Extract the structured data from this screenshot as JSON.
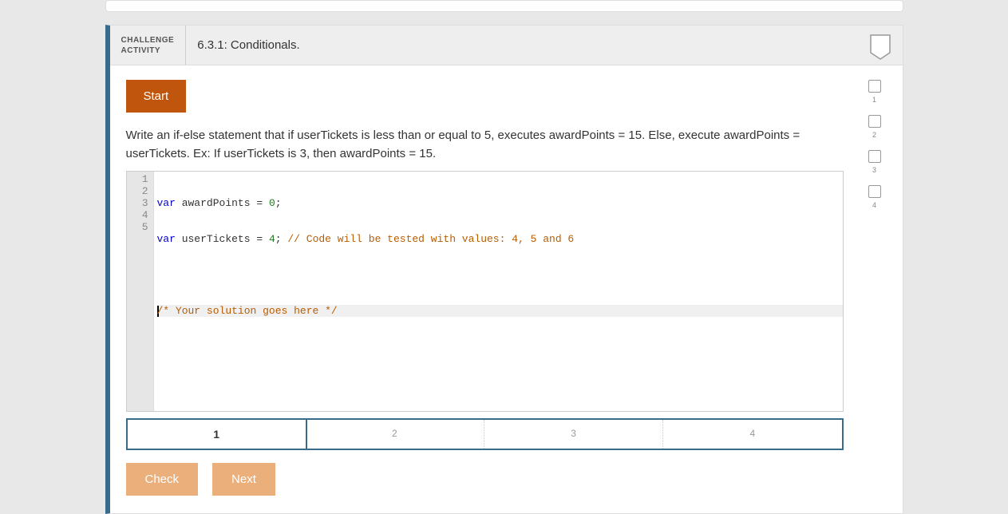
{
  "activity": {
    "tag_line1": "CHALLENGE",
    "tag_line2": "ACTIVITY",
    "title": "6.3.1: Conditionals."
  },
  "buttons": {
    "start": "Start",
    "check": "Check",
    "next": "Next"
  },
  "prompt": "Write an if-else statement that if userTickets is less than or equal to 5, executes awardPoints = 15. Else, execute awardPoints = userTickets. Ex: If userTickets is 3, then awardPoints = 15.",
  "code": {
    "lines": [
      {
        "n": "1",
        "kw": "var",
        "rest": " awardPoints = ",
        "num": "0",
        "tail": ";"
      },
      {
        "n": "2",
        "kw": "var",
        "rest": " userTickets = ",
        "num": "4",
        "tail": "; ",
        "comment": "// Code will be tested with values: 4, 5 and 6"
      },
      {
        "n": "3"
      },
      {
        "n": "4",
        "comment": "/* Your solution goes here */"
      },
      {
        "n": "5"
      }
    ]
  },
  "testnav": [
    {
      "label": "1",
      "active": true
    },
    {
      "label": "2",
      "active": false
    },
    {
      "label": "3",
      "active": false
    },
    {
      "label": "4",
      "active": false
    }
  ],
  "sidechecks": [
    {
      "label": "1"
    },
    {
      "label": "2"
    },
    {
      "label": "3"
    },
    {
      "label": "4"
    }
  ]
}
